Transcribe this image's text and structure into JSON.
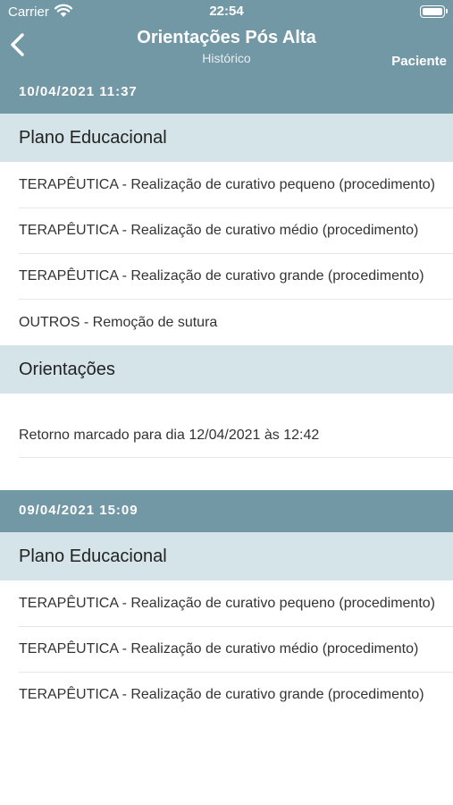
{
  "status_bar": {
    "carrier": "Carrier",
    "time": "22:54"
  },
  "nav": {
    "title": "Orientações Pós Alta",
    "subtitle": "Histórico",
    "right_button": "Paciente",
    "back_icon": "chevron-left-icon"
  },
  "colors": {
    "header_bg": "#7298a6",
    "section_bg": "#d4e4e8",
    "text": "#333333"
  },
  "groups": [
    {
      "date": "10/04/2021 11:37",
      "plano_title": "Plano Educacional",
      "plano_items": [
        "TERAPÊUTICA - Realização de curativo pequeno (procedimento)",
        "TERAPÊUTICA - Realização de curativo médio (procedimento)",
        "TERAPÊUTICA - Realização de curativo grande (procedimento)",
        "OUTROS - Remoção de sutura"
      ],
      "orientacoes_title": "Orientações",
      "orientacoes_items": [
        "Retorno marcado para dia 12/04/2021 às 12:42"
      ]
    },
    {
      "date": "09/04/2021 15:09",
      "plano_title": "Plano Educacional",
      "plano_items": [
        "TERAPÊUTICA - Realização de curativo pequeno (procedimento)",
        "TERAPÊUTICA - Realização de curativo médio (procedimento)",
        "TERAPÊUTICA - Realização de curativo grande (procedimento)"
      ]
    }
  ]
}
